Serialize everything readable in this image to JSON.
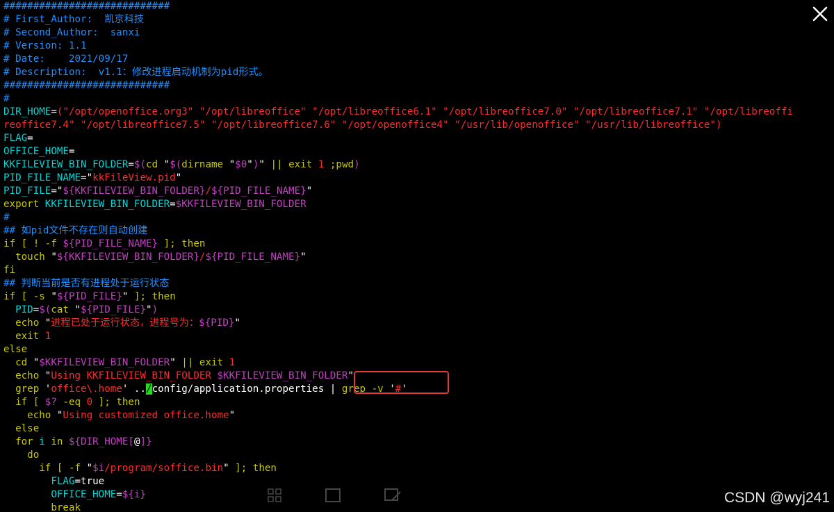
{
  "code_lines": [
    [
      [
        "c-comment",
        "############################"
      ]
    ],
    [
      [
        "c-comment",
        "# First_Author:  凯京科技"
      ]
    ],
    [
      [
        "c-comment",
        "# Second_Author:  sanxi"
      ]
    ],
    [
      [
        "c-comment",
        "# Version: 1.1"
      ]
    ],
    [
      [
        "c-comment",
        "# Date:    2021/09/17"
      ]
    ],
    [
      [
        "c-comment",
        "# Description:  v1.1：修改进程启动机制为pid形式。"
      ]
    ],
    [
      [
        "c-comment",
        "############################"
      ]
    ],
    [
      [
        "c-comment",
        "#"
      ]
    ],
    [
      [
        "c-var",
        "DIR_HOME"
      ],
      [
        "c-white",
        "="
      ],
      [
        "c-string",
        "(\"/opt/openoffice.org3\" \"/opt/libreoffice\" \"/opt/libreoffice6.1\" \"/opt/libreoffice7.0\" \"/opt/libreoffice7.1\" \"/opt/libreoffi"
      ]
    ],
    [
      [
        "c-string",
        "reoffice7.4\" \"/opt/libreoffice7.5\" \"/opt/libreoffice7.6\" \"/opt/openoffice4\" \"/usr/lib/openoffice\" \"/usr/lib/libreoffice\")"
      ]
    ],
    [
      [
        "c-var",
        "FLAG"
      ],
      [
        "c-white",
        "="
      ]
    ],
    [
      [
        "c-var",
        "OFFICE_HOME"
      ],
      [
        "c-white",
        "="
      ]
    ],
    [
      [
        "c-var",
        "KKFILEVIEW_BIN_FOLDER"
      ],
      [
        "c-white",
        "="
      ],
      [
        "c-purple",
        "$("
      ],
      [
        "c-kw",
        "cd "
      ],
      [
        "c-white",
        "\""
      ],
      [
        "c-purple",
        "$("
      ],
      [
        "c-kw",
        "dirname "
      ],
      [
        "c-white",
        "\""
      ],
      [
        "c-purple",
        "$0"
      ],
      [
        "c-white",
        "\""
      ],
      [
        "c-purple",
        ")"
      ],
      [
        "c-white",
        "\" "
      ],
      [
        "c-kw",
        "|| exit "
      ],
      [
        "c-string",
        "1"
      ],
      [
        "c-kw",
        " ;pwd"
      ],
      [
        "c-purple",
        ")"
      ]
    ],
    [
      [
        "c-var",
        "PID_FILE_NAME"
      ],
      [
        "c-white",
        "="
      ],
      [
        "c-white",
        "\""
      ],
      [
        "c-string",
        "kkFileView.pid"
      ],
      [
        "c-white",
        "\""
      ]
    ],
    [
      [
        "c-var",
        "PID_FILE"
      ],
      [
        "c-white",
        "="
      ],
      [
        "c-white",
        "\""
      ],
      [
        "c-purple",
        "${KKFILEVIEW_BIN_FOLDER}"
      ],
      [
        "c-string",
        "/"
      ],
      [
        "c-purple",
        "${PID_FILE_NAME}"
      ],
      [
        "c-white",
        "\""
      ]
    ],
    [
      [
        "c-kw",
        "export "
      ],
      [
        "c-var",
        "KKFILEVIEW_BIN_FOLDER"
      ],
      [
        "c-white",
        "="
      ],
      [
        "c-purple",
        "$KKFILEVIEW_BIN_FOLDER"
      ]
    ],
    [
      [
        "c-comment",
        "#"
      ]
    ],
    [
      [
        "c-comment",
        "## 如pid文件不存在则自动创建"
      ]
    ],
    [
      [
        "c-kw",
        "if [ ! -f "
      ],
      [
        "c-purple",
        "${PID_FILE_NAME}"
      ],
      [
        "c-kw",
        " ]; then"
      ]
    ],
    [
      [
        "c-kw",
        "  touch "
      ],
      [
        "c-white",
        "\""
      ],
      [
        "c-purple",
        "${KKFILEVIEW_BIN_FOLDER}"
      ],
      [
        "c-string",
        "/"
      ],
      [
        "c-purple",
        "${PID_FILE_NAME}"
      ],
      [
        "c-white",
        "\""
      ]
    ],
    [
      [
        "c-kw",
        "fi"
      ]
    ],
    [
      [
        "c-comment",
        "## 判断当前是否有进程处于运行状态"
      ]
    ],
    [
      [
        "c-kw",
        "if [ -s "
      ],
      [
        "c-white",
        "\""
      ],
      [
        "c-purple",
        "${PID_FILE}"
      ],
      [
        "c-white",
        "\""
      ],
      [
        "c-kw",
        " ]; then"
      ]
    ],
    [
      [
        "c-var",
        "  PID"
      ],
      [
        "c-white",
        "="
      ],
      [
        "c-purple",
        "$("
      ],
      [
        "c-kw",
        "cat "
      ],
      [
        "c-white",
        "\""
      ],
      [
        "c-purple",
        "${PID_FILE}"
      ],
      [
        "c-white",
        "\""
      ],
      [
        "c-purple",
        ")"
      ]
    ],
    [
      [
        "c-kw",
        "  echo "
      ],
      [
        "c-white",
        "\""
      ],
      [
        "c-string",
        "进程已处于运行状态，进程号为："
      ],
      [
        "c-purple",
        "${PID}"
      ],
      [
        "c-white",
        "\""
      ]
    ],
    [
      [
        "c-kw",
        "  exit "
      ],
      [
        "c-string",
        "1"
      ]
    ],
    [
      [
        "c-kw",
        "else"
      ]
    ],
    [
      [
        "c-kw",
        "  cd "
      ],
      [
        "c-white",
        "\""
      ],
      [
        "c-purple",
        "$KKFILEVIEW_BIN_FOLDER"
      ],
      [
        "c-white",
        "\""
      ],
      [
        "c-kw",
        " || exit "
      ],
      [
        "c-string",
        "1"
      ]
    ],
    [
      [
        "c-kw",
        "  echo "
      ],
      [
        "c-white",
        "\""
      ],
      [
        "c-string",
        "Using KKFILEVIEW_BIN_FOLDER "
      ],
      [
        "c-purple",
        "$KKFILEVIEW_BIN_FOLDER"
      ],
      [
        "c-white",
        "\""
      ]
    ],
    [
      [
        "c-kw",
        "  grep "
      ],
      [
        "c-white",
        "'"
      ],
      [
        "c-string",
        "office\\.home"
      ],
      [
        "c-white",
        "' .."
      ],
      [
        "c-cursor",
        "/"
      ],
      [
        "c-white",
        "config/application.properties | "
      ],
      [
        "c-kw",
        "grep -v "
      ],
      [
        "c-white",
        "'"
      ],
      [
        "c-string",
        "#"
      ],
      [
        "c-white",
        "'"
      ]
    ],
    [
      [
        "c-kw",
        "  if [ "
      ],
      [
        "c-purple",
        "$?"
      ],
      [
        "c-kw",
        " -eq "
      ],
      [
        "c-string",
        "0"
      ],
      [
        "c-kw",
        " ]; then"
      ]
    ],
    [
      [
        "c-kw",
        "    echo "
      ],
      [
        "c-white",
        "\""
      ],
      [
        "c-string",
        "Using customized office.home"
      ],
      [
        "c-white",
        "\""
      ]
    ],
    [
      [
        "c-kw",
        "  else"
      ]
    ],
    [
      [
        "c-kw",
        "  for "
      ],
      [
        "c-var",
        "i"
      ],
      [
        "c-kw",
        " in "
      ],
      [
        "c-purple",
        "${DIR_HOME["
      ],
      [
        "c-white",
        "@"
      ],
      [
        "c-purple",
        "]}"
      ]
    ],
    [
      [
        "c-kw",
        "    do"
      ]
    ],
    [
      [
        "c-kw",
        "      if [ -f "
      ],
      [
        "c-white",
        "\""
      ],
      [
        "c-purple",
        "$i"
      ],
      [
        "c-string",
        "/program/soffice.bin"
      ],
      [
        "c-white",
        "\""
      ],
      [
        "c-kw",
        " ]; then"
      ]
    ],
    [
      [
        "c-var",
        "        FLAG"
      ],
      [
        "c-white",
        "="
      ],
      [
        "c-white",
        "true"
      ]
    ],
    [
      [
        "c-var",
        "        OFFICE_HOME"
      ],
      [
        "c-white",
        "="
      ],
      [
        "c-purple",
        "${i}"
      ]
    ],
    [
      [
        "c-kw",
        "        break"
      ]
    ]
  ],
  "icons": {
    "close": "close-icon",
    "toolbar": [
      "grid-icon",
      "fit-screen-icon",
      "edit-icon"
    ]
  },
  "colors": {
    "background": "#000000",
    "comment": "#1e90ff",
    "variable": "#00d7d7",
    "string": "#ff2a2a",
    "keyword": "#c8c800",
    "expansion": "#c040c0",
    "cursor": "#22dd22",
    "highlight_box": "#e53935"
  },
  "watermark": "CSDN @wyj241"
}
